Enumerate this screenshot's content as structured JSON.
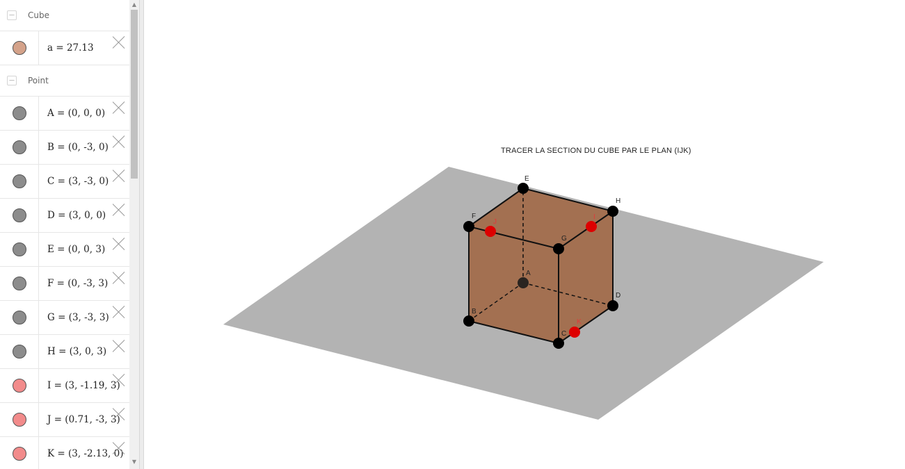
{
  "algebra": {
    "groups": [
      {
        "title": "Cube",
        "toggle": "—",
        "items": [
          {
            "text": "a = 27.13",
            "color": "#d4a28a"
          }
        ]
      },
      {
        "title": "Point",
        "toggle": "—",
        "items": [
          {
            "text": "A = (0, 0, 0)",
            "color": "#8c8c8c"
          },
          {
            "text": "B = (0, -3, 0)",
            "color": "#8c8c8c"
          },
          {
            "text": "C = (3, -3, 0)",
            "color": "#8c8c8c"
          },
          {
            "text": "D = (3, 0, 0)",
            "color": "#8c8c8c"
          },
          {
            "text": "E = (0, 0, 3)",
            "color": "#8c8c8c"
          },
          {
            "text": "F = (0, -3, 3)",
            "color": "#8c8c8c"
          },
          {
            "text": "G = (3, -3, 3)",
            "color": "#8c8c8c"
          },
          {
            "text": "H = (3, 0, 3)",
            "color": "#8c8c8c"
          },
          {
            "text": "I = (3, -1.19, 3)",
            "color": "#f28b8b"
          },
          {
            "text": "J = (0.71, -3, 3)",
            "color": "#f28b8b"
          },
          {
            "text": "K = (3, -2.13, 0)",
            "color": "#f28b8b"
          }
        ]
      }
    ]
  },
  "scrollbar": {
    "up": "▲",
    "down": "▼"
  },
  "graphics": {
    "caption": "TRACER LA SECTION DU CUBE PAR LE PLAN (IJK)",
    "labels": {
      "A": "A",
      "B": "B",
      "C": "C",
      "D": "D",
      "E": "E",
      "F": "F",
      "G": "G",
      "H": "H",
      "I": "I",
      "J": "J",
      "K": "K"
    },
    "colors": {
      "plane": "#b3b3b3",
      "cube_face": "#a0613c",
      "vertex": "#000000",
      "point_red": "#dd0000"
    }
  }
}
